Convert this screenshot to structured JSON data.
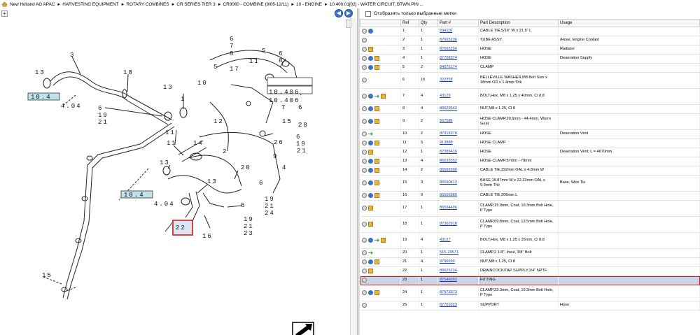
{
  "breadcrumb": [
    "New Holland AG APAC",
    "HARVESTING EQUIPMENT",
    "ROTARY COMBINES",
    "CR SERIES TIER 3",
    "CR9060 - COMBINE (9/06-12/11)",
    "10 - ENGINE",
    "10.400.01[02] - WATER CIRCUIT, BTWN PIN ..."
  ],
  "left": {
    "expand": "+",
    "prev": "◀",
    "next": "▶"
  },
  "diagram": {
    "callouts": [
      "3",
      "13",
      "10.4",
      "4.04",
      "18",
      "13",
      "6",
      "19",
      "21",
      "10",
      "1",
      "11",
      "11",
      "14",
      "13",
      "10.4",
      "4.04",
      "6",
      "7",
      "8",
      "5",
      "17",
      "11",
      "5",
      "6",
      "8",
      "12",
      "10.406",
      "10.406",
      "7",
      "6",
      "15",
      "28",
      "26",
      "6",
      "19",
      "21",
      "9",
      "4",
      "2",
      "20",
      "13",
      "6",
      "19",
      "21",
      "24",
      "6",
      "19",
      "21",
      "23",
      "22",
      "16",
      "15"
    ]
  },
  "filter": {
    "label": "Отобразить только выбранные метки"
  },
  "table": {
    "headers": [
      "",
      "Ref",
      "Qty",
      "Part #",
      "Part Description",
      "Usage"
    ],
    "rows": [
      {
        "icons": [
          "gear",
          "info"
        ],
        "ref": "1",
        "qty": "1",
        "part": "594116",
        "desc": "CABLE TIE,5/16\" W x 21.5\" L",
        "usage": ""
      },
      {
        "icons": [
          "gear"
        ],
        "ref": "2",
        "qty": "1",
        "part": "87665236",
        "desc": "TUBE ASSY.",
        "usage": "/Hose, Engine Coolant"
      },
      {
        "icons": [
          "gear",
          "box"
        ],
        "ref": "3",
        "qty": "1",
        "part": "87665234",
        "desc": "HOSE",
        "usage": "Radiator"
      },
      {
        "icons": [
          "gear",
          "info",
          "box"
        ],
        "ref": "4",
        "qty": "1",
        "part": "87708374",
        "desc": "HOSE",
        "usage": "Deaeration Supply"
      },
      {
        "icons": [
          "gear",
          "info",
          "box"
        ],
        "ref": "5",
        "qty": "2",
        "part": "84076174",
        "desc": "CLAMP",
        "usage": ""
      },
      {
        "icons": [
          "gear"
        ],
        "ref": "6",
        "qty": "16",
        "part": "322358",
        "desc": "BELLEVILLE WASHER,M8 Bolt Size x 18mm OD x 1.4mm Thk",
        "usage": ""
      },
      {
        "icons": [
          "gear",
          "info",
          "arr",
          "box"
        ],
        "ref": "7",
        "qty": "4",
        "part": "43129",
        "desc": "BOLT,Hex, M8 x 1.25 x 40mm, Cl 8.8",
        "usage": ""
      },
      {
        "icons": [
          "gear",
          "info",
          "box"
        ],
        "ref": "8",
        "qty": "4",
        "part": "86629542",
        "desc": "NUT,M8 x 1.25, Cl 8",
        "usage": ""
      },
      {
        "icons": [
          "gear",
          "info",
          "box"
        ],
        "ref": "9",
        "qty": "2",
        "part": "507586",
        "desc": "HOSE CLAMP,20.6mm - 44.4mm, Worm Gear",
        "usage": ""
      },
      {
        "icons": [
          "gear",
          "arr"
        ],
        "ref": "10",
        "qty": "2",
        "part": "87316370",
        "desc": "HOSE",
        "usage": "Deaeration Vent"
      },
      {
        "icons": [
          "gear",
          "info",
          "box"
        ],
        "ref": "11",
        "qty": "5",
        "part": "913888",
        "desc": "HOSE CLAMP",
        "usage": ""
      },
      {
        "icons": [
          "gear",
          "box"
        ],
        "ref": "12",
        "qty": "1",
        "part": "87389416",
        "desc": "HOSE",
        "usage": "Deaeration Vent; L = 4670mm"
      },
      {
        "icons": [
          "gear",
          "info",
          "box"
        ],
        "ref": "13",
        "qty": "4",
        "part": "86633352",
        "desc": "HOSE CLAMP,57mm - 79mm",
        "usage": ""
      },
      {
        "icons": [
          "gear",
          "info",
          "box"
        ],
        "ref": "14",
        "qty": "2",
        "part": "86566996",
        "desc": "CABLE TIE,292mm OAL x 4.8mm W",
        "usage": ""
      },
      {
        "icons": [
          "gear",
          "info",
          "box"
        ],
        "ref": "15",
        "qty": "3",
        "part": "86590413",
        "desc": "BASE,15.87mm W x 22.22mm OAL x 9.9mm Thk",
        "usage": "Base, Wire Tie"
      },
      {
        "icons": [
          "gear",
          "info",
          "box"
        ],
        "ref": "16",
        "qty": "9",
        "part": "86566989",
        "desc": "CABLE TIE,208mm L",
        "usage": ""
      },
      {
        "icons": [
          "gear",
          "box"
        ],
        "ref": "17",
        "qty": "1",
        "part": "86594406",
        "desc": "CLAMP,15.9mm, Coat, 10.3mm Bolt Hole, P Type",
        "usage": ""
      },
      {
        "icons": [
          "gear",
          "box"
        ],
        "ref": "18",
        "qty": "1",
        "part": "87302918",
        "desc": "CLAMP,69.8mm, Coat, 13.5mm Bolt Hole, P Type",
        "usage": ""
      },
      {
        "icons": [
          "gear",
          "info",
          "arr",
          "box"
        ],
        "ref": "19",
        "qty": "4",
        "part": "43127",
        "desc": "BOLT,Hex, M8 x 1.25 x 25mm, Cl 8.8",
        "usage": ""
      },
      {
        "icons": [
          "gear",
          "arr"
        ],
        "ref": "20",
        "qty": "1",
        "part": "515-23571",
        "desc": "CLAMP,2 1/4\", Insul, 3/8\" Bolt",
        "usage": ""
      },
      {
        "icons": [
          "gear",
          "info",
          "box"
        ],
        "ref": "21",
        "qty": "4",
        "part": "9706690",
        "desc": "NUT,M8 x 1.25, Cl 8",
        "usage": ""
      },
      {
        "icons": [
          "gear",
          "box"
        ],
        "ref": "22",
        "qty": "1",
        "part": "86625234",
        "desc": "DRAINCOCK/TAP SUPPLY,1/4\" NPTF",
        "usage": ""
      },
      {
        "icons": [
          "gear"
        ],
        "ref": "23",
        "qty": "1",
        "part": "87546092",
        "desc": "FITTING",
        "usage": "",
        "selected": true
      },
      {
        "icons": [
          "gear",
          "info",
          "box"
        ],
        "ref": "24",
        "qty": "1",
        "part": "87573373",
        "desc": "CLAMP,33.3mm, Coat, 10.3mm Bolt Hole, P Type",
        "usage": ""
      },
      {
        "icons": [
          "gear"
        ],
        "ref": "25",
        "qty": "1",
        "part": "87701023",
        "desc": "SUPPORT",
        "usage": "Hose"
      }
    ]
  },
  "colors": {
    "link": "#1a3fb8",
    "selected_row": "#c9d5e6",
    "highlight_box": "#d21a1a",
    "callout_fill": "#bfe3e8",
    "nav_button": "#3c74c8"
  }
}
